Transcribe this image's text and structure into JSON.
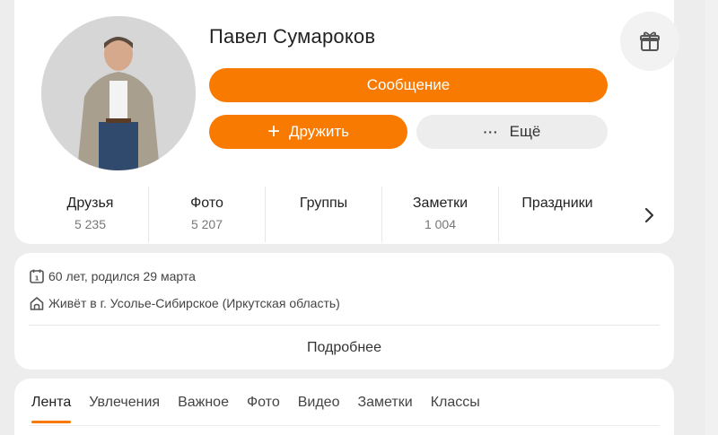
{
  "profile": {
    "name": "Павел Сумароков",
    "buttons": {
      "message": "Сообщение",
      "friend": "Дружить",
      "more": "Ещё"
    }
  },
  "stats": [
    {
      "label": "Друзья",
      "count": "5 235"
    },
    {
      "label": "Фото",
      "count": "5 207"
    },
    {
      "label": "Группы",
      "count": ""
    },
    {
      "label": "Заметки",
      "count": "1 004"
    },
    {
      "label": "Праздники",
      "count": ""
    }
  ],
  "info": {
    "age": "60 лет, родился 29 марта",
    "city": "Живёт в г. Усолье-Сибирское (Иркутская область)",
    "more_link": "Подробнее"
  },
  "tabs": [
    "Лента",
    "Увлечения",
    "Важное",
    "Фото",
    "Видео",
    "Заметки",
    "Классы"
  ],
  "colors": {
    "accent": "#f97a00",
    "page_bg": "#ededed"
  },
  "icons": {
    "gift": "gift-icon",
    "calendar": "calendar-icon",
    "home": "home-icon",
    "plus": "plus-icon",
    "dots": "dots-icon",
    "chevron": "chevron-right-icon"
  }
}
